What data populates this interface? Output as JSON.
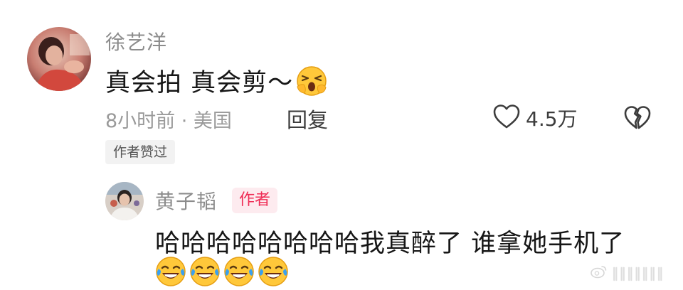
{
  "comment": {
    "username": "徐艺洋",
    "text": "真会拍 真会剪～",
    "meta": "8小时前 · 美国",
    "reply_label": "回复",
    "like_count": "4.5万",
    "liked_by_author_badge": "作者赞过"
  },
  "reply": {
    "username": "黄子韬",
    "author_badge": "作者",
    "text": "哈哈哈哈哈哈哈哈我真醉了 谁拿她手机了",
    "laugh_emoji_count": 4
  },
  "icons": {
    "main_emoji": "screaming-face-icon",
    "like": "heart-outline-icon",
    "dislike": "broken-heart-icon",
    "reply_emoji": "laughing-crying-face-icon"
  },
  "colors": {
    "author_badge_text": "#ef2d56",
    "author_badge_bg": "#fdebef",
    "muted_text": "#9a9a9a"
  }
}
